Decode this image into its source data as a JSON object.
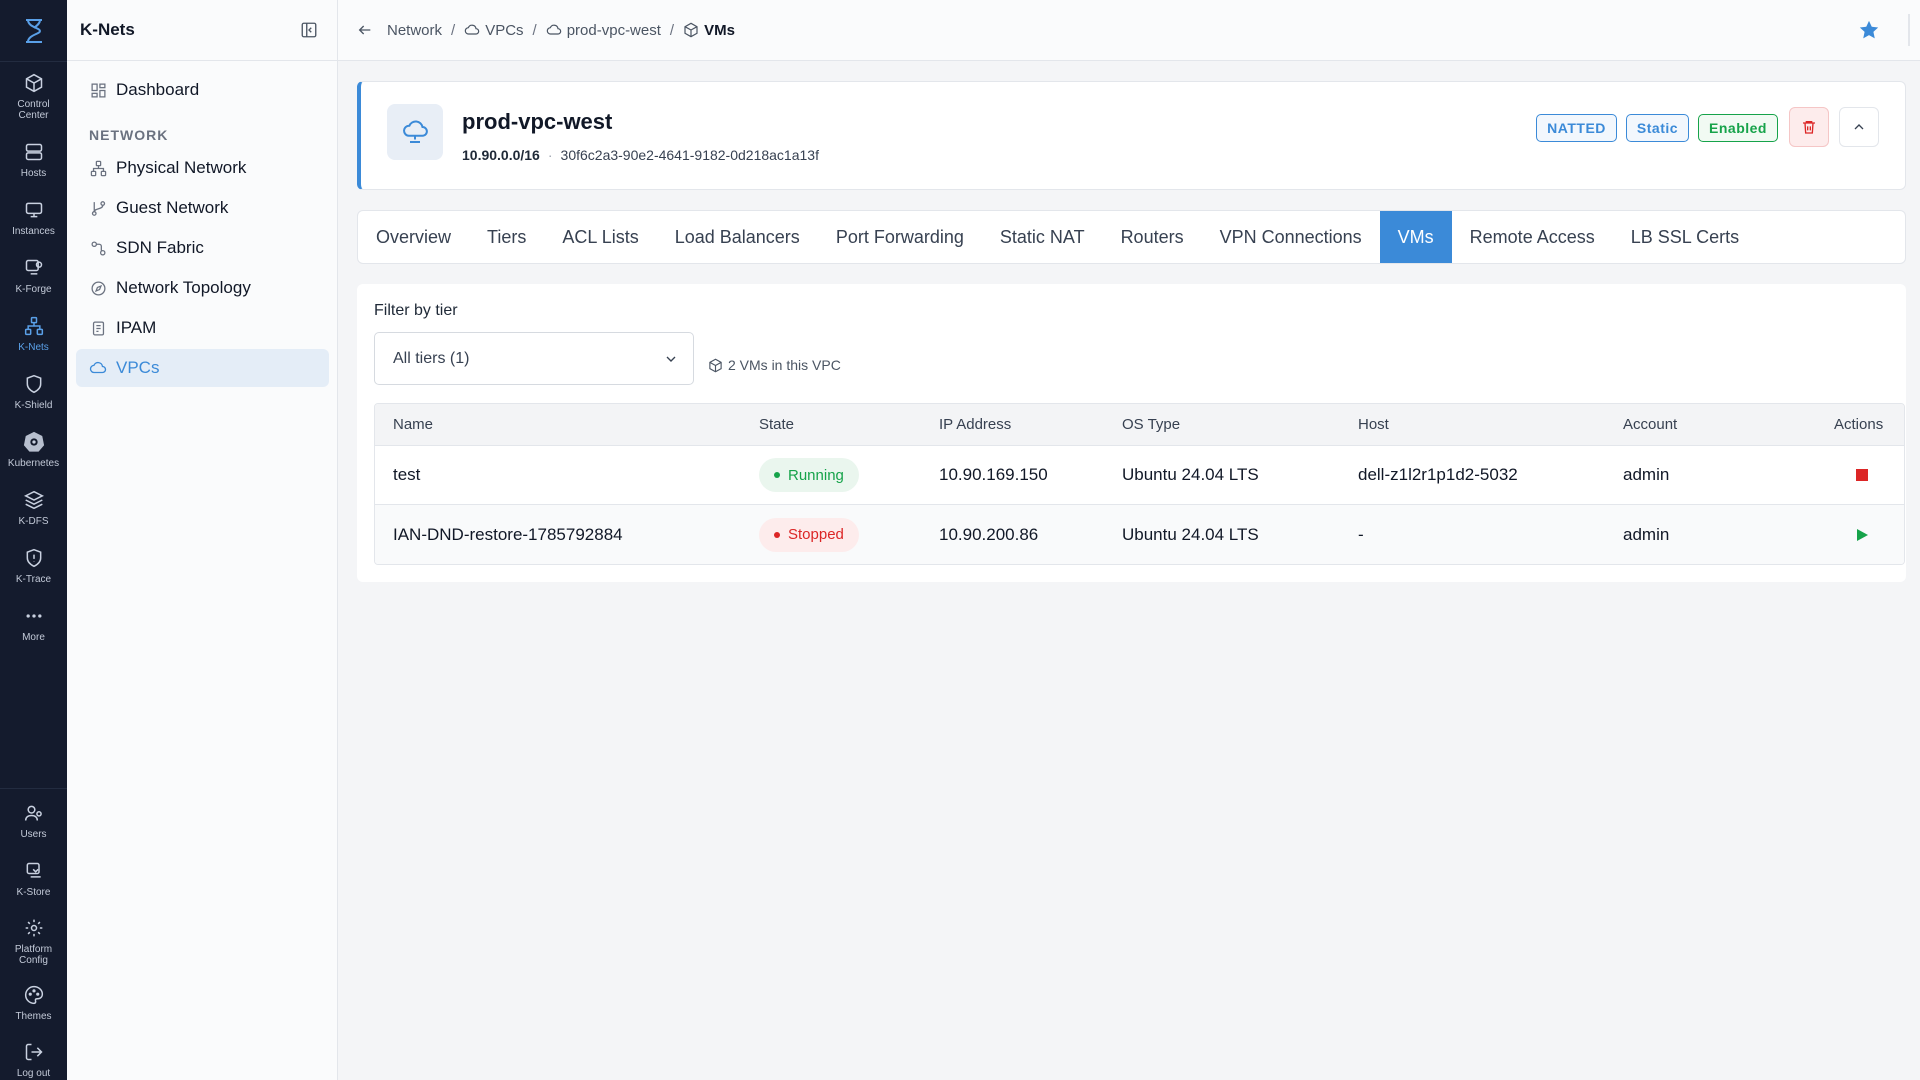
{
  "rail": {
    "logo_icon": "hourglass-logo-icon",
    "items": [
      {
        "label": "Control Center",
        "icon": "cube-icon"
      },
      {
        "label": "Hosts",
        "icon": "server-icon"
      },
      {
        "label": "Instances",
        "icon": "monitor-icon"
      },
      {
        "label": "K-Forge",
        "icon": "forge-icon"
      },
      {
        "label": "K-Nets",
        "icon": "network-icon",
        "active": true
      },
      {
        "label": "K-Shield",
        "icon": "shield-icon"
      },
      {
        "label": "Kubernetes",
        "icon": "kubernetes-icon"
      },
      {
        "label": "K-DFS",
        "icon": "layers-icon"
      },
      {
        "label": "K-Trace",
        "icon": "trace-icon"
      },
      {
        "label": "More",
        "icon": "more-icon"
      }
    ],
    "bottom_items": [
      {
        "label": "Users",
        "icon": "users-icon"
      },
      {
        "label": "K-Store",
        "icon": "store-icon"
      },
      {
        "label": "Platform Config",
        "icon": "gear-icon"
      },
      {
        "label": "Themes",
        "icon": "palette-icon"
      },
      {
        "label": "Log out",
        "icon": "logout-icon"
      }
    ]
  },
  "sidebar": {
    "title": "K-Nets",
    "dashboard": "Dashboard",
    "section": "NETWORK",
    "items": [
      {
        "label": "Physical Network"
      },
      {
        "label": "Guest Network"
      },
      {
        "label": "SDN Fabric"
      },
      {
        "label": "Network Topology"
      },
      {
        "label": "IPAM"
      },
      {
        "label": "VPCs",
        "active": true
      }
    ]
  },
  "breadcrumb": {
    "items": [
      "Network",
      "VPCs",
      "prod-vpc-west",
      "VMs"
    ],
    "separator": "/"
  },
  "vpc": {
    "name": "prod-vpc-west",
    "cidr": "10.90.0.0/16",
    "id": "30f6c2a3-90e2-4641-9182-0d218ac1a13f",
    "badges": [
      "NATTED",
      "Static",
      "Enabled"
    ]
  },
  "tabs": [
    "Overview",
    "Tiers",
    "ACL Lists",
    "Load Balancers",
    "Port Forwarding",
    "Static NAT",
    "Routers",
    "VPN Connections",
    "VMs",
    "Remote Access",
    "LB SSL Certs"
  ],
  "active_tab": "VMs",
  "filter": {
    "label": "Filter by tier",
    "selected": "All tiers (1)",
    "count_text": "2 VMs in this VPC"
  },
  "table": {
    "columns": [
      "Name",
      "State",
      "IP Address",
      "OS Type",
      "Host",
      "Account",
      "Actions"
    ],
    "rows": [
      {
        "name": "test",
        "state": "Running",
        "ip": "10.90.169.150",
        "os": "Ubuntu 24.04 LTS",
        "host": "dell-z1l2r1p1d2-5032",
        "account": "admin",
        "action": "stop"
      },
      {
        "name": "IAN-DND-restore-1785792884",
        "state": "Stopped",
        "ip": "10.90.200.86",
        "os": "Ubuntu 24.04 LTS",
        "host": "-",
        "account": "admin",
        "action": "start"
      }
    ]
  },
  "colors": {
    "accent": "#3b8ad8",
    "rail_bg": "#141b2d",
    "running": "#16a34a",
    "stopped": "#dc2626"
  }
}
